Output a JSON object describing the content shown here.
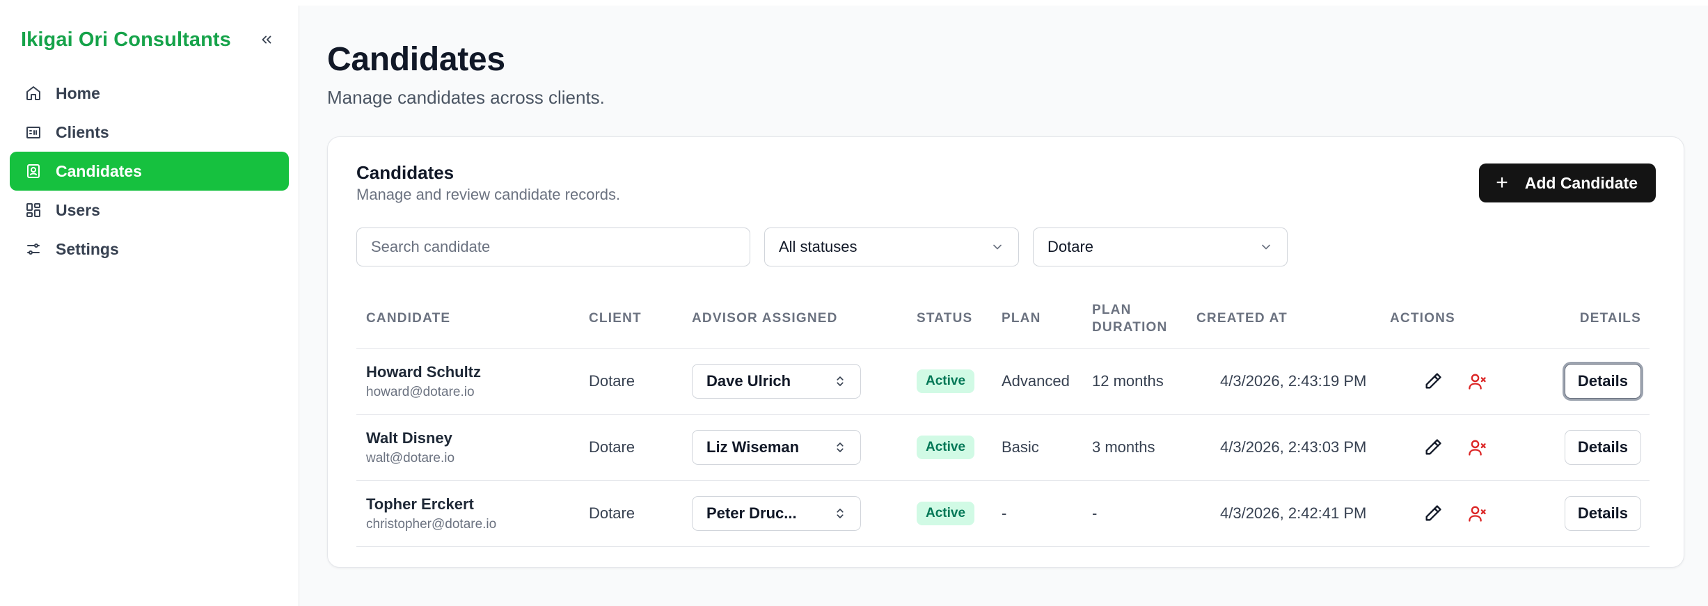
{
  "sidebar": {
    "brand": "Ikigai Ori Consultants",
    "items": [
      {
        "label": "Home",
        "icon": "home-icon"
      },
      {
        "label": "Clients",
        "icon": "building-icon"
      },
      {
        "label": "Candidates",
        "icon": "contact-card-icon",
        "active": true
      },
      {
        "label": "Users",
        "icon": "grid-icon"
      },
      {
        "label": "Settings",
        "icon": "sliders-icon"
      }
    ]
  },
  "page": {
    "title": "Candidates",
    "subtitle": "Manage candidates across clients."
  },
  "card": {
    "title": "Candidates",
    "subtitle": "Manage and review candidate records.",
    "add_label": "Add Candidate"
  },
  "filters": {
    "search_placeholder": "Search candidate",
    "status_value": "All statuses",
    "client_value": "Dotare"
  },
  "table": {
    "headers": [
      "CANDIDATE",
      "CLIENT",
      "ADVISOR ASSIGNED",
      "STATUS",
      "PLAN",
      "PLAN DURATION",
      "CREATED AT",
      "ACTIONS",
      "DETAILS"
    ],
    "details_label": "Details",
    "rows": [
      {
        "name": "Howard Schultz",
        "email": "howard@dotare.io",
        "client": "Dotare",
        "advisor": "Dave Ulrich",
        "status": "Active",
        "plan": "Advanced",
        "duration": "12 months",
        "created": "4/3/2026, 2:43:19 PM"
      },
      {
        "name": "Walt Disney",
        "email": "walt@dotare.io",
        "client": "Dotare",
        "advisor": "Liz Wiseman",
        "status": "Active",
        "plan": "Basic",
        "duration": "3 months",
        "created": "4/3/2026, 2:43:03 PM"
      },
      {
        "name": "Topher Erckert",
        "email": "christopher@dotare.io",
        "client": "Dotare",
        "advisor": "Peter Druc...",
        "status": "Active",
        "plan": "-",
        "duration": "-",
        "created": "4/3/2026, 2:42:41 PM"
      }
    ]
  },
  "colors": {
    "brand": "#16a34a",
    "active_nav": "#16c13f",
    "badge_bg": "#d1fae5",
    "badge_text": "#047857",
    "remove_icon": "#dc2626"
  }
}
